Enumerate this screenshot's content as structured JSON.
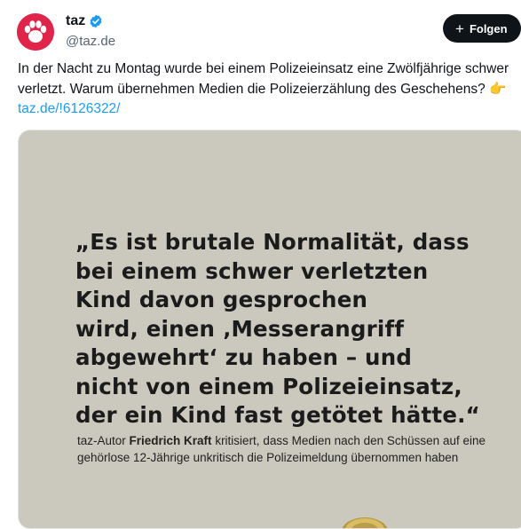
{
  "account": {
    "display_name": "taz",
    "handle": "@taz.de",
    "follow_label": "Folgen"
  },
  "tweet": {
    "text": "In der Nacht zu Montag wurde bei einem Polizeieinsatz eine Zwölfjährige schwer verletzt. Warum übernehmen Medien die Polizeierzählung des Geschehens?",
    "emoji": "👉",
    "link": "taz.de/!6126322/"
  },
  "media": {
    "quote_lines": [
      "„Es ist brutale Normalität, dass",
      "bei einem schwer verletzten",
      "Kind davon gesprochen",
      "wird, einen ‚Messerangriff",
      "abgewehrt‘ zu haben – und",
      "nicht von einem Polizeieinsatz,",
      "der ein Kind fast getötet hätte.“"
    ],
    "caption_prefix": "taz-Autor ",
    "caption_author": "Friedrich Kraft",
    "caption_rest": " kritisiert, dass Medien nach den Schüssen auf eine gehörlose 12-Jährige unkritisch die Polizeimeldung übernommen haben"
  },
  "colors": {
    "brand": "#e0254b",
    "link": "#1d9bf0",
    "media_bg": "#cbc8bd"
  }
}
